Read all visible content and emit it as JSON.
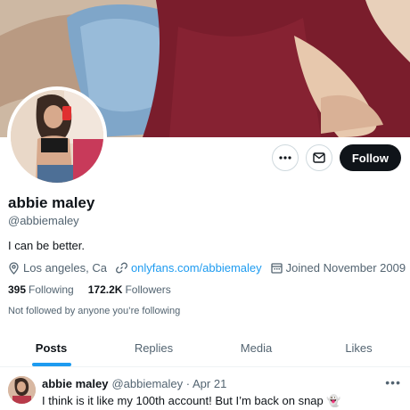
{
  "profile": {
    "name": "abbie maley",
    "handle": "@abbiemaley",
    "bio": "I can be better.",
    "location": "Los angeles, Ca",
    "website": "onlyfans.com/abbiemaley",
    "joined": "Joined November 2009",
    "not_followed_text": "Not followed by anyone you’re following"
  },
  "stats": {
    "following_count": "395",
    "following_label": "Following",
    "followers_count": "172.2K",
    "followers_label": "Followers"
  },
  "actions": {
    "more_glyph": "•••",
    "follow_label": "Follow"
  },
  "tabs": [
    {
      "label": "Posts"
    },
    {
      "label": "Replies"
    },
    {
      "label": "Media"
    },
    {
      "label": "Likes"
    }
  ],
  "tweet": {
    "author_name": "abbie maley",
    "author_handle": "@abbiemaley",
    "separator": "·",
    "date": "Apr 21",
    "text": "I think is it like my 100th account! But I’m back on snap 👻",
    "more_glyph": "•••"
  },
  "colors": {
    "accent": "#1d9bf0",
    "text_primary": "#0f1419",
    "text_secondary": "#536471",
    "follow_bg": "#0f1419"
  },
  "icons": [
    "more-icon",
    "mail-icon",
    "location-icon",
    "link-icon",
    "calendar-icon"
  ]
}
